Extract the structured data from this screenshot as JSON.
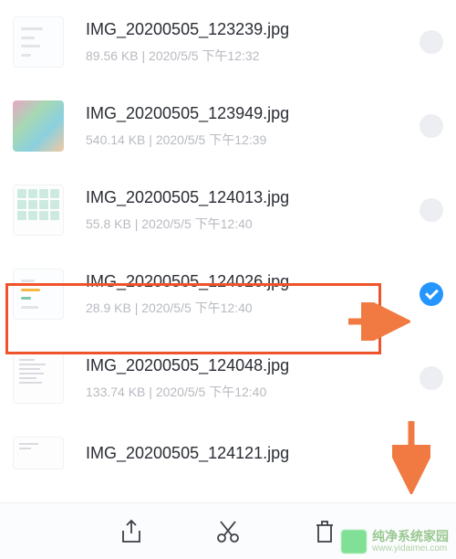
{
  "files": [
    {
      "name": "IMG_20200505_123239.jpg",
      "size": "89.56 KB",
      "date": "2020/5/5 下午12:32",
      "selected": false,
      "thumb": "doc"
    },
    {
      "name": "IMG_20200505_123949.jpg",
      "size": "540.14 KB",
      "date": "2020/5/5 下午12:39",
      "selected": false,
      "thumb": "photo"
    },
    {
      "name": "IMG_20200505_124013.jpg",
      "size": "55.8 KB",
      "date": "2020/5/5 下午12:40",
      "selected": false,
      "thumb": "grid"
    },
    {
      "name": "IMG_20200505_124026.jpg",
      "size": "28.9 KB",
      "date": "2020/5/5 下午12:40",
      "selected": true,
      "thumb": "lines"
    },
    {
      "name": "IMG_20200505_124048.jpg",
      "size": "133.74 KB",
      "date": "2020/5/5 下午12:40",
      "selected": false,
      "thumb": "text"
    },
    {
      "name": "IMG_20200505_124121.jpg",
      "size": "",
      "date": "",
      "selected": false,
      "thumb": "text"
    }
  ],
  "meta_sep": "  |  ",
  "watermark": {
    "title": "纯净系统家园",
    "sub": "www.yidaimei.com"
  },
  "colors": {
    "accent": "#2596ff",
    "highlight": "#f0532a",
    "arrow": "#f07a41"
  }
}
